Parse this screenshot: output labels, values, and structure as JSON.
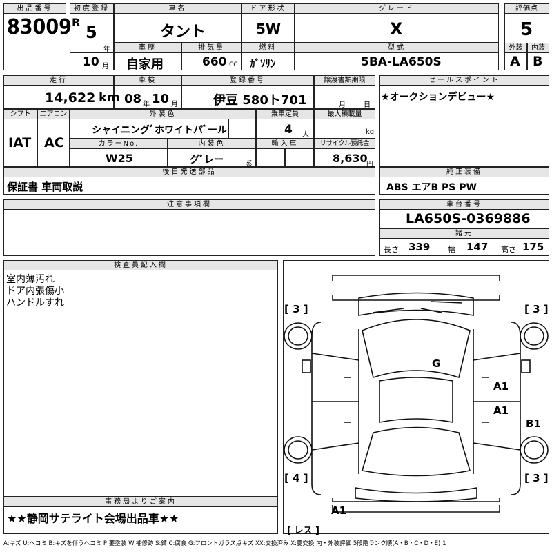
{
  "labels": {
    "lot_no": "出品番号",
    "first_reg": "初度登録",
    "car_name": "車名",
    "door": "ドア形状",
    "grade": "グレード",
    "score": "評価点",
    "history": "車歴",
    "displacement": "排気量",
    "fuel": "燃料",
    "model": "型式",
    "exterior": "外装",
    "interior": "内装",
    "mileage": "走行",
    "inspection": "車検",
    "plate": "登録番号",
    "transfer": "譲渡書類期限",
    "sales_point": "セールスポイント",
    "shift": "シフト",
    "ac": "エアコン",
    "ext_color": "外装色",
    "capacity": "乗車定員",
    "max_load": "最大積載量",
    "color_no": "カラーNo.",
    "int_color": "内装色",
    "import": "輸入車",
    "recycle": "リサイクル預託金",
    "later_parts": "後日発送部品",
    "equipment": "純正装備",
    "notes": "注意事項欄",
    "chassis": "車台番号",
    "specs": "諸元",
    "inspector": "検査員記入欄",
    "office": "事務局よりご案内",
    "len": "長さ",
    "wid": "幅",
    "hgt": "高さ",
    "unit_year": "年",
    "unit_month": "月",
    "unit_day": "日",
    "unit_cc": "CC",
    "unit_km": "km",
    "unit_person": "人",
    "unit_kg": "kg",
    "unit_yen": "円",
    "unit_kei": "系",
    "reiwa": "R"
  },
  "values": {
    "lot_no": "83009",
    "reg_year": "5",
    "reg_month": "10",
    "car_name": "タント",
    "door": "5W",
    "grade": "X",
    "score": "5",
    "history": "自家用",
    "displacement": "660",
    "fuel": "ｶﾞｿﾘﾝ",
    "model": "5BA-LA650S",
    "exterior": "A",
    "interior": "B",
    "mileage": "14,622",
    "insp_year": "08",
    "insp_month": "10",
    "plate": "伊豆 580ト701",
    "sales_point": "★オークションデビュー★",
    "shift": "IAT",
    "ac": "AC",
    "ext_color": "シャイニングﾞホワイトパﾞール",
    "capacity": "4",
    "color_no": "W25",
    "int_color": "グﾞレー",
    "recycle": "8,630",
    "later_parts": "保証書 車両取説",
    "equipment": "ABS エアB PS PW",
    "chassis": "LA650S-0369886",
    "length": "339",
    "width": "147",
    "height": "175",
    "inspector_notes": [
      "室内薄汚れ",
      "ドア内張傷小",
      "ハンドルすれ"
    ],
    "office": "★★静岡サテライト会場出品車★★",
    "footer": "A:キズ U:ヘコミ B:キズを伴うヘコミ P:要塗装 W:補修跡 S:錆 C:腐食 G:フロントガラス点キズ XX:交換済み X:要交換 内・外装評価 5段階ランク順(A・B・C・D・E) 1"
  },
  "diagram": {
    "marks": [
      "[ 3 ]",
      "[ 3 ]",
      "G",
      "A1",
      "A1",
      "B1",
      "[ 4 ]",
      "[ 3 ]",
      "A1",
      "[ レス ]"
    ]
  }
}
